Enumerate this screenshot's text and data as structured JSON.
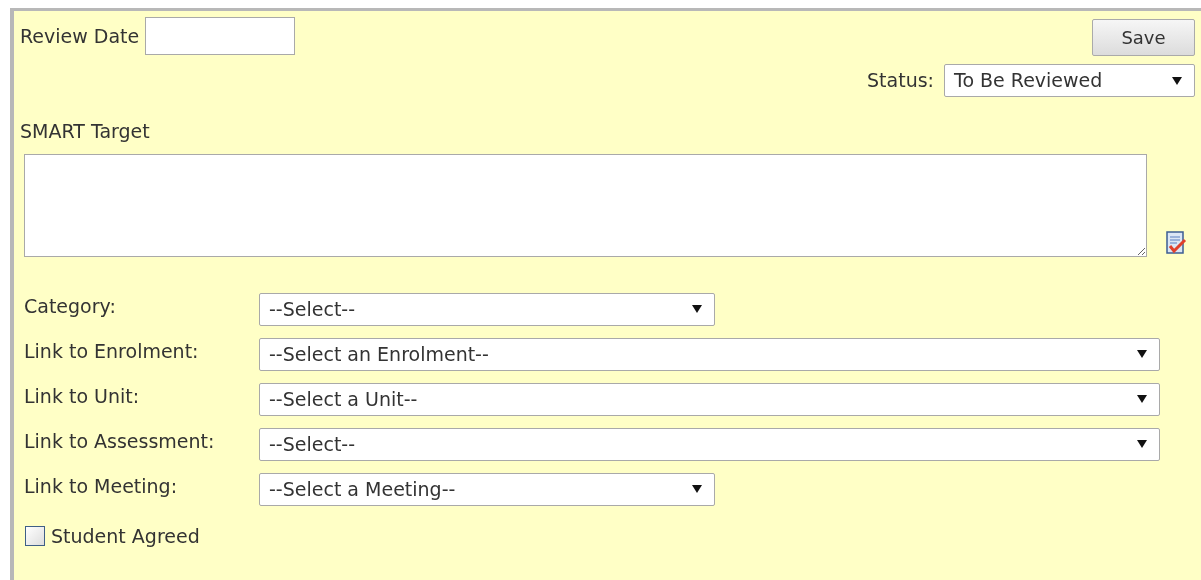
{
  "review_date": {
    "label": "Review Date"
  },
  "save_button": "Save",
  "status": {
    "label": "Status:",
    "value": "To Be Reviewed"
  },
  "smart_target": {
    "label": "SMART Target"
  },
  "fields": [
    {
      "label": "Category:",
      "value": "--Select--",
      "wide": false
    },
    {
      "label": "Link to Enrolment:",
      "value": "--Select an Enrolment--",
      "wide": true
    },
    {
      "label": "Link to Unit:",
      "value": "--Select a Unit--",
      "wide": true
    },
    {
      "label": "Link to Assessment:",
      "value": "--Select--",
      "wide": true
    },
    {
      "label": "Link to Meeting:",
      "value": "--Select a Meeting--",
      "wide": false
    }
  ],
  "student_agreed": {
    "label": "Student Agreed",
    "checked": false
  }
}
